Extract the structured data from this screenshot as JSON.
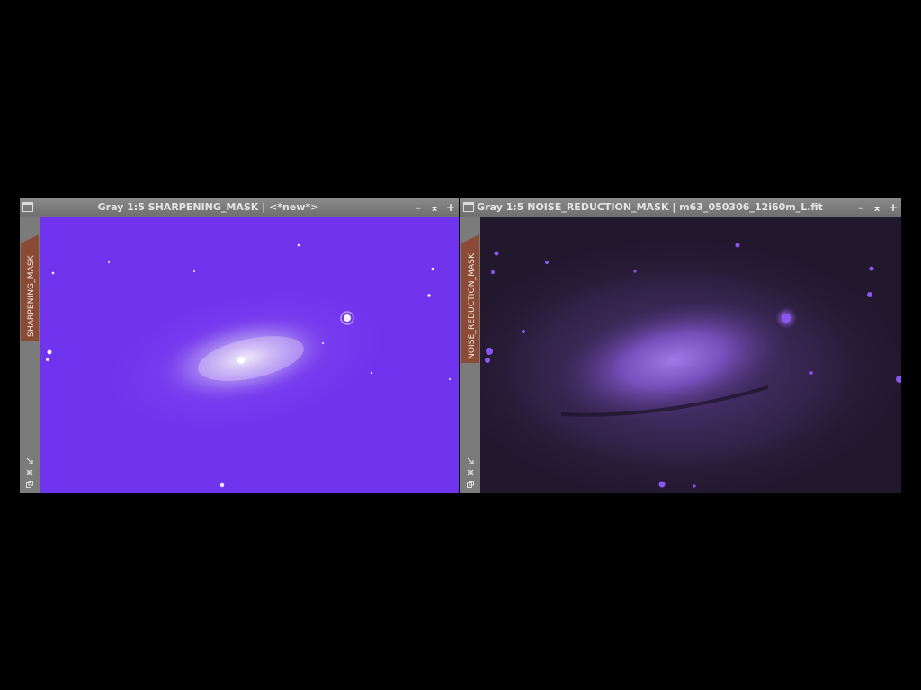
{
  "windows": [
    {
      "title": "Gray 1:5 SHARPENING_MASK | <*new*>",
      "tab_label": "SHARPENING_MASK",
      "buttons": {
        "minimize": "–",
        "shade": "⌅",
        "maximize": "+"
      },
      "view_color": "#7033ee"
    },
    {
      "title": "Gray 1:5 NOISE_REDUCTION_MASK | m63_050306_12i60m_L.fit",
      "tab_label": "NOISE_REDUCTION_MASK",
      "buttons": {
        "minimize": "–",
        "shade": "⌅",
        "maximize": "+"
      },
      "view_color": "#22182e"
    }
  ],
  "colors": {
    "desktop": "#000000",
    "frame": "#7b7b7b",
    "tab": "#8a4a35",
    "title_text": "#e4e4e4"
  },
  "icons": [
    "system-menu-icon",
    "minimize-icon",
    "shade-icon",
    "maximize-icon",
    "resize-arrow-icon",
    "zoom-icon",
    "new-window-icon"
  ]
}
